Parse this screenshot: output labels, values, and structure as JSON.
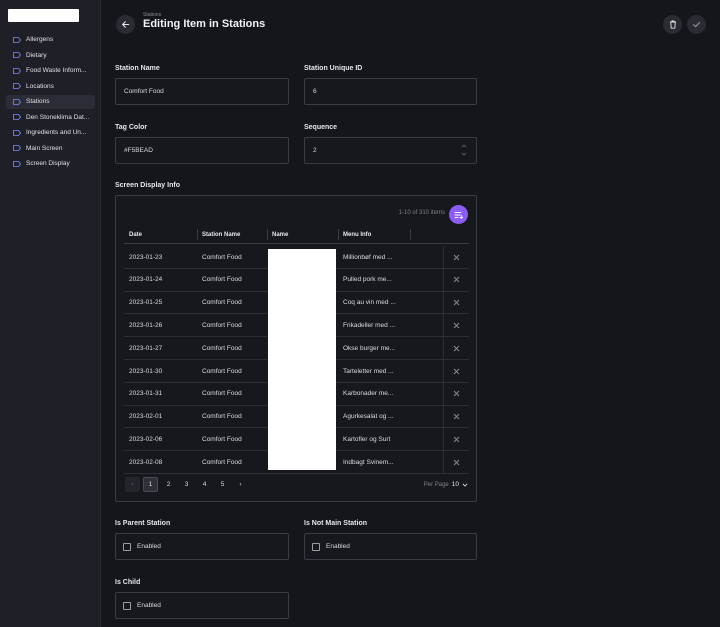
{
  "sidebar": {
    "items": [
      {
        "label": "Allergens"
      },
      {
        "label": "Dietary"
      },
      {
        "label": "Food Waste Inform..."
      },
      {
        "label": "Locations"
      },
      {
        "label": "Stations"
      },
      {
        "label": "Den Stoneklima Dat..."
      },
      {
        "label": "Ingredients and Un..."
      },
      {
        "label": "Main Screen"
      },
      {
        "label": "Screen Display"
      }
    ]
  },
  "header": {
    "breadcrumb": "Stations",
    "title": "Editing Item in Stations"
  },
  "form": {
    "station_name": {
      "label": "Station Name",
      "value": "Comfort Food"
    },
    "station_unique_id": {
      "label": "Station Unique ID",
      "value": "6"
    },
    "tag_color": {
      "label": "Tag Color",
      "value": "#F5BEAD"
    },
    "sequence": {
      "label": "Sequence",
      "value": "2"
    },
    "screen_display_info": {
      "label": "Screen Display Info"
    },
    "is_parent_station": {
      "label": "Is Parent Station",
      "checkbox_label": "Enabled"
    },
    "is_not_main_station": {
      "label": "Is Not Main Station",
      "checkbox_label": "Enabled"
    },
    "is_child": {
      "label": "Is Child",
      "checkbox_label": "Enabled"
    }
  },
  "table": {
    "items_count": "1-10 of 310 items",
    "columns": [
      "Date",
      "Station Name",
      "Name",
      "Menu Info"
    ],
    "rows": [
      {
        "date": "2023-01-23",
        "station": "Comfort Food",
        "menu": "Millionbøf med ..."
      },
      {
        "date": "2023-01-24",
        "station": "Comfort Food",
        "menu": "Pulled pork me..."
      },
      {
        "date": "2023-01-25",
        "station": "Comfort Food",
        "menu": "Coq au vin med ..."
      },
      {
        "date": "2023-01-26",
        "station": "Comfort Food",
        "menu": "Frikadeller med ..."
      },
      {
        "date": "2023-01-27",
        "station": "Comfort Food",
        "menu": "Okse burger me..."
      },
      {
        "date": "2023-01-30",
        "station": "Comfort Food",
        "menu": "Tarteletter med ..."
      },
      {
        "date": "2023-01-31",
        "station": "Comfort Food",
        "menu": "Karbonader me..."
      },
      {
        "date": "2023-02-01",
        "station": "Comfort Food",
        "menu": "Agurkesalat og ..."
      },
      {
        "date": "2023-02-06",
        "station": "Comfort Food",
        "menu": "Kartofler og Surt"
      },
      {
        "date": "2023-02-08",
        "station": "Comfort Food",
        "menu": "Indbagt Svinem..."
      }
    ],
    "pagination": {
      "pages": [
        "1",
        "2",
        "3",
        "4",
        "5"
      ],
      "current": "1",
      "prev_icon": "‹",
      "next_icon": "›",
      "per_page_label": "Per Page",
      "per_page_value": "10"
    }
  },
  "colors": {
    "accent": "#8b5cf6",
    "background": "#15161b",
    "sidebar": "#1f2027"
  }
}
